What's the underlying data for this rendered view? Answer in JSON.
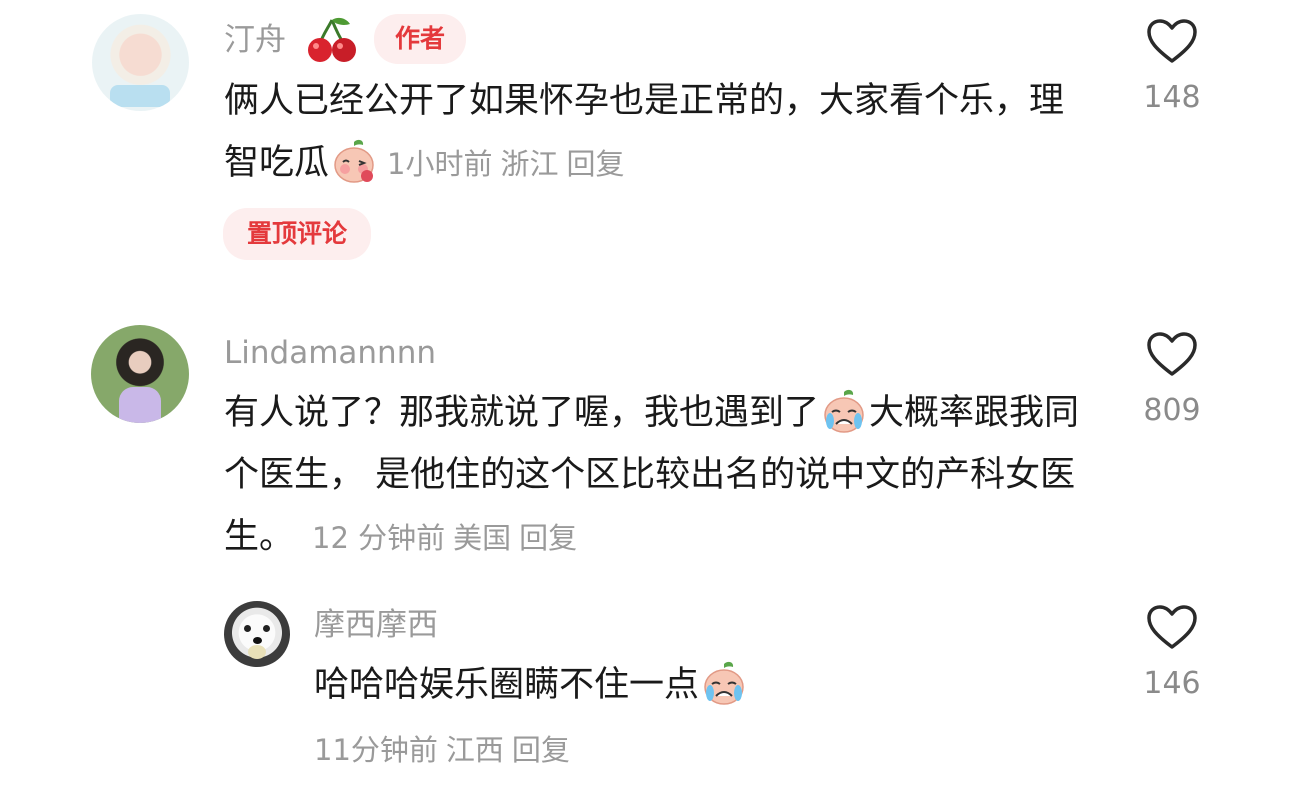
{
  "comments": [
    {
      "username": "汀舟",
      "author_badge": "作者",
      "badge_emoji": "cherry-icon",
      "text_part1": "俩人已经公开了如果怀孕也是正常的，大家看个乐，理智吃瓜",
      "emoji": "blush-face-icon",
      "time": "1小时前",
      "location": "浙江",
      "reply_label": "回复",
      "pinned_label": "置顶评论",
      "like_count": "148"
    },
    {
      "username": "Lindamannnn",
      "text_part1": "有人说了？那我就说了喔，我也遇到了",
      "emoji": "crying-face-icon",
      "text_part2": "大概率跟我同个医生， 是他住的这个区比较出名的说中文的产科女医生。",
      "time": "12 分钟前",
      "location": "美国",
      "reply_label": "回复",
      "like_count": "809"
    },
    {
      "username": "摩西摩西",
      "text_part1": "哈哈哈娱乐圈瞒不住一点",
      "emoji": "crying-face-icon",
      "time": "11分钟前",
      "location": "江西",
      "reply_label": "回复",
      "like_count": "146"
    }
  ],
  "colors": {
    "accent": "#e4393c",
    "meta_gray": "#9a9a9a",
    "text": "#1a1a1a"
  }
}
